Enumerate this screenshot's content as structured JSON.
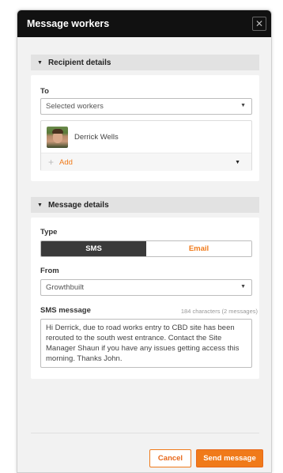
{
  "modal": {
    "title": "Message workers",
    "close_glyph": "✕"
  },
  "recipient": {
    "section_title": "Recipient details",
    "to_label": "To",
    "select_value": "Selected workers",
    "workers": [
      {
        "name": "Derrick Wells"
      }
    ],
    "add_label": "Add"
  },
  "message": {
    "section_title": "Message details",
    "type_label": "Type",
    "type_options": [
      "SMS",
      "Email"
    ],
    "type_selected": "SMS",
    "from_label": "From",
    "from_value": "Growthbuilt",
    "sms_label": "SMS message",
    "char_count": "184 characters (2 messages)",
    "body": "Hi Derrick, due to road works entry to CBD site has been rerouted to the south west entrance. Contact the Site Manager Shaun if you have any issues getting access this morning. Thanks John."
  },
  "footer": {
    "cancel_label": "Cancel",
    "send_label": "Send message"
  },
  "colors": {
    "accent": "#f07a1a",
    "header_bg": "#111111",
    "panel_bg": "#f2f2f2",
    "active_toggle": "#3a3a3a"
  }
}
